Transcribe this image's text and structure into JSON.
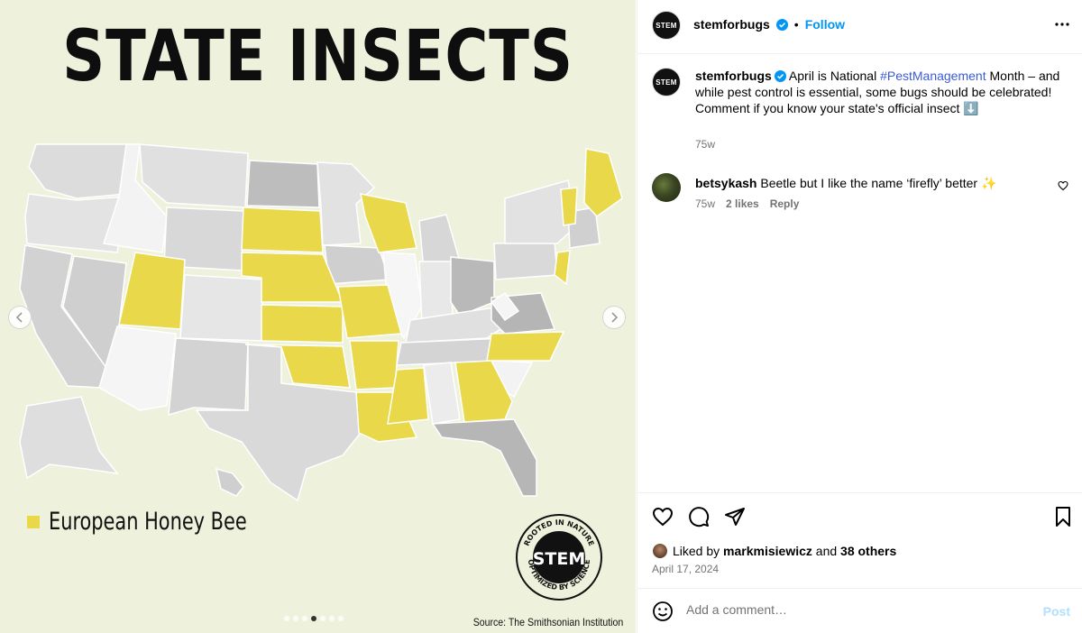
{
  "media": {
    "title": "STATE INSECTS",
    "legend_label": "European Honey Bee",
    "source": "Source: The Smithsonian Institution",
    "badge_text": "STEM",
    "badge_ring_top": "ROOTED IN NATURE",
    "badge_ring_bottom": "OPTIMIZED BY SCIENCE",
    "highlight_color": "#e8d84a",
    "carousel_total": 7,
    "carousel_active": 4
  },
  "post": {
    "username": "stemforbugs",
    "avatar_text": "STEM",
    "follow_label": "Follow",
    "caption_pre": "April is National ",
    "caption_hashtag": "#PestManagement",
    "caption_post": " Month – and while pest control is essential, some bugs should be celebrated! Comment if you know your state's official insect ⬇️",
    "caption_time": "75w",
    "comment": {
      "username": "betsykash",
      "text": " Beetle but I like the name ‘firefly’ better ✨",
      "time": "75w",
      "likes": "2 likes",
      "reply": "Reply"
    },
    "liked_by_pre": "Liked by ",
    "liked_by_user": "markmisiewicz",
    "liked_by_mid": " and ",
    "liked_by_others": "38 others",
    "date": "April 17, 2024",
    "comment_placeholder": "Add a comment…",
    "post_label": "Post"
  }
}
